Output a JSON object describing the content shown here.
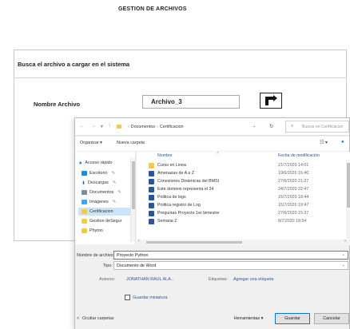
{
  "page": {
    "title": "GESTION DE ARCHIVOS"
  },
  "form": {
    "header": "Busca el archivo a cargar en el sistema",
    "field_label": "Nombre Archivo",
    "field_value": "Archivo_3",
    "upload_icon": "upload-arrow-icon"
  },
  "dialog": {
    "breadcrumb": [
      "Documentos",
      "Certificacion"
    ],
    "search_placeholder": "Buscar en Certificacion",
    "toolbar": {
      "organize": "Organizar ▾",
      "new_folder": "Nueva carpeta"
    },
    "nav": [
      {
        "label": "Acceso rápido",
        "icon": "star-icon",
        "color": "#1e6fc8"
      },
      {
        "label": "Escritorio",
        "icon": "desktop-icon",
        "color": "#1e88e5"
      },
      {
        "label": "Descargas",
        "icon": "download-icon",
        "color": "#1565c0"
      },
      {
        "label": "Documentos",
        "icon": "documents-icon",
        "color": "#78909c"
      },
      {
        "label": "Imágenes",
        "icon": "images-icon",
        "color": "#42a5f5"
      },
      {
        "label": "Certificacion",
        "icon": "folder-icon",
        "color": "#f2c94c"
      },
      {
        "label": "Gestion deSegur",
        "icon": "folder-icon",
        "color": "#f2c94c"
      },
      {
        "label": "Phyton",
        "icon": "folder-icon",
        "color": "#f2c94c"
      }
    ],
    "columns": {
      "name": "Nombre",
      "date": "Fecha de modificación"
    },
    "files": [
      {
        "name": "Curso en Linea",
        "date": "21/7/2020 14:01",
        "type": "folder",
        "color": "#f2c94c"
      },
      {
        "name": "Amenazas de A a Z",
        "date": "19/6/2020 15:40",
        "type": "word",
        "color": "#2b579a"
      },
      {
        "name": "Conexiones Dinámicas del BMSI",
        "date": "27/6/2020 21:27",
        "type": "word",
        "color": "#2b579a"
      },
      {
        "name": "Este dominio representa el 24",
        "date": "24/7/2020 22:47",
        "type": "word",
        "color": "#2b579a"
      },
      {
        "name": "Politica de logs",
        "date": "15/7/2020 18:44",
        "type": "word",
        "color": "#2b579a"
      },
      {
        "name": "Politica registro de Log",
        "date": "15/7/2020 19:47",
        "type": "word",
        "color": "#2b579a"
      },
      {
        "name": "Preguntas Proyecto 1er bimestre",
        "date": "27/6/2020 15:37",
        "type": "word",
        "color": "#2b579a"
      },
      {
        "name": "Semana 2",
        "date": "8/7/2020 18:54",
        "type": "word",
        "color": "#2b579a"
      }
    ],
    "filename_label": "Nombre de archivo:",
    "filename_value": "Proyecto Python",
    "type_label": "Tipo:",
    "type_value": "Documento de Word",
    "authors_label": "Autores:",
    "authors_value": "JONATHAN RAUL ALA...",
    "tags_label": "Etiquetas:",
    "tags_value": "Agregar una etiqueta",
    "thumbnail_label": "Guardar miniatura",
    "hide_folders": "Ocultar carpetas",
    "tools_button": "Herramientas ▾",
    "save_button": "Guardar",
    "cancel_button": "Cancelar"
  }
}
